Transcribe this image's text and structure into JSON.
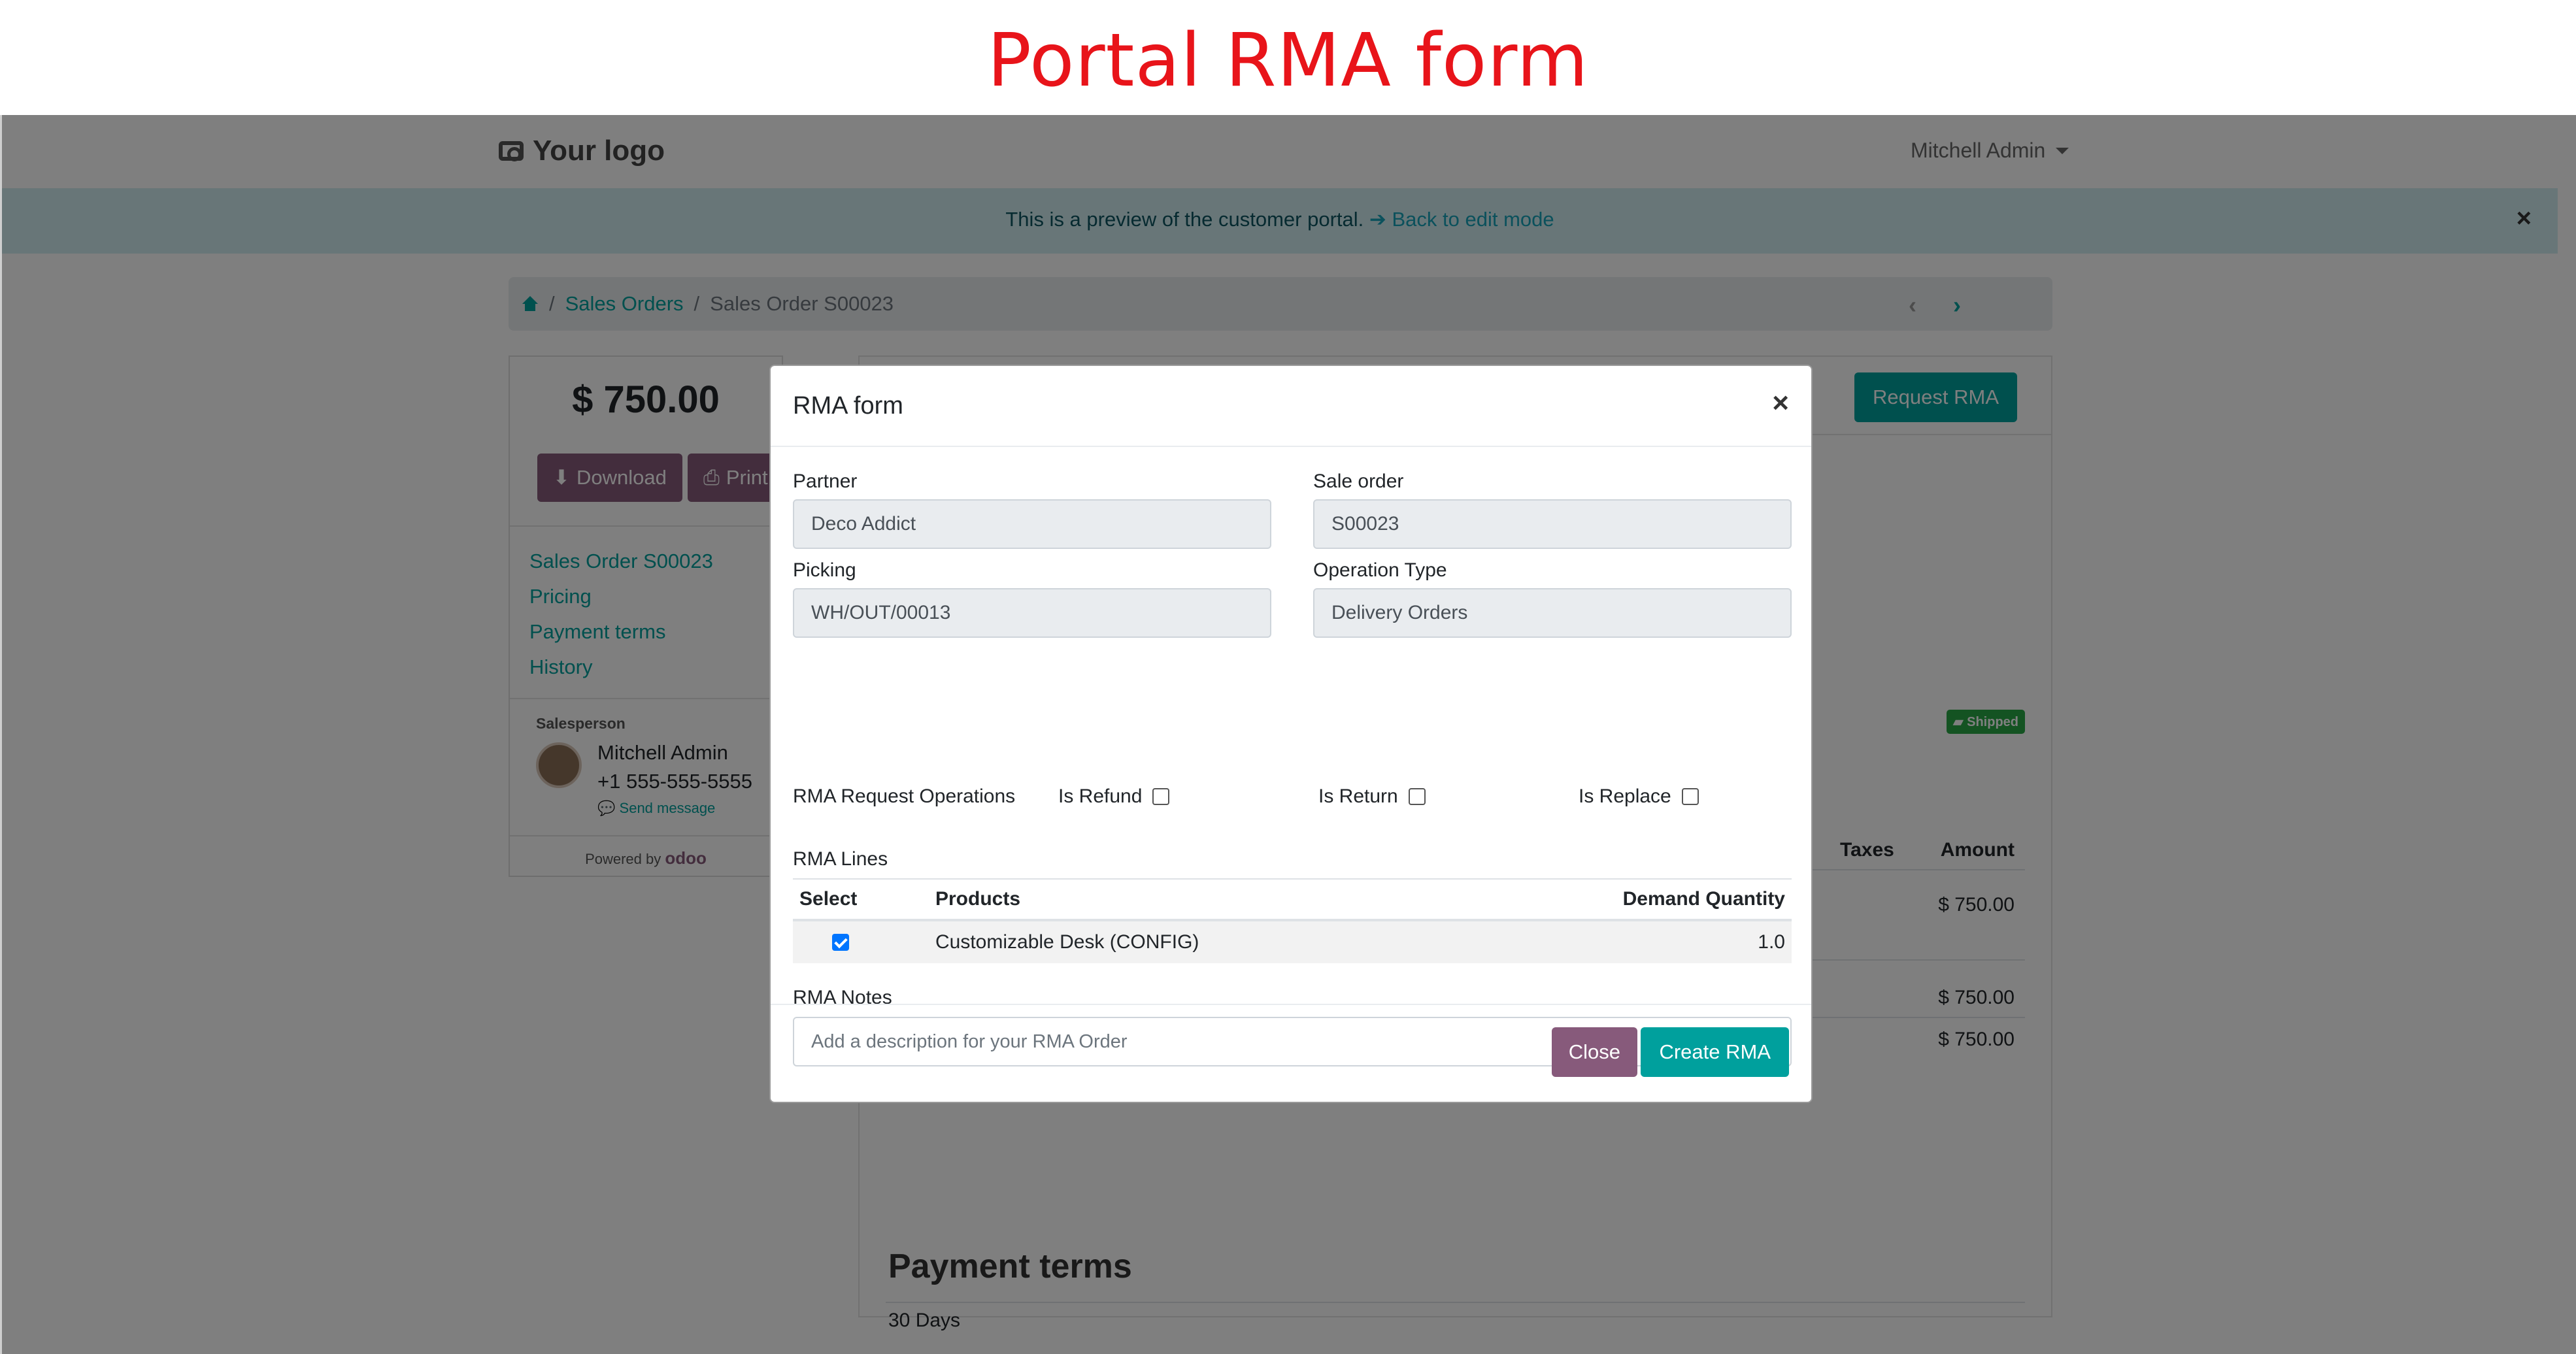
{
  "banner": {
    "title": "Portal RMA form"
  },
  "navbar": {
    "logo_text": "Your logo",
    "user_name": "Mitchell Admin"
  },
  "preview": {
    "text": "This is a preview of the customer portal.",
    "link": "Back to edit mode"
  },
  "breadcrumb": {
    "items": [
      "Sales Orders",
      "Sales Order S00023"
    ]
  },
  "sidebar": {
    "amount": "$ 750.00",
    "download_label": "Download",
    "print_label": "Print",
    "links": [
      "Sales Order S00023",
      "Pricing",
      "Payment terms",
      "History"
    ],
    "salesperson_label": "Salesperson",
    "salesperson_name": "Mitchell Admin",
    "salesperson_phone": "+1 555-555-5555",
    "send_message": "Send message",
    "powered_by": "Powered by",
    "powered_brand": "odoo"
  },
  "main": {
    "request_rma_label": "Request RMA",
    "shipped_badge": "Shipped",
    "columns": [
      "Taxes",
      "Amount"
    ],
    "amounts": [
      "$ 750.00",
      "$ 750.00",
      "$ 750.00"
    ],
    "payment_terms_title": "Payment terms",
    "payment_terms_value": "30 Days"
  },
  "modal": {
    "title": "RMA form",
    "partner_label": "Partner",
    "partner_value": "Deco Addict",
    "sale_order_label": "Sale order",
    "sale_order_value": "S00023",
    "picking_label": "Picking",
    "picking_value": "WH/OUT/00013",
    "operation_type_label": "Operation Type",
    "operation_type_value": "Delivery Orders",
    "ops_label": "RMA Request Operations",
    "is_refund": "Is Refund",
    "is_return": "Is Return",
    "is_replace": "Is Replace",
    "lines_label": "RMA Lines",
    "table": {
      "headers": [
        "Select",
        "Products",
        "Demand Quantity"
      ],
      "rows": [
        {
          "selected": true,
          "product": "Customizable Desk (CONFIG)",
          "quantity": "1.0"
        }
      ]
    },
    "notes_label": "RMA Notes",
    "notes_placeholder": "Add a description for your RMA Order",
    "close_label": "Close",
    "create_label": "Create RMA"
  }
}
